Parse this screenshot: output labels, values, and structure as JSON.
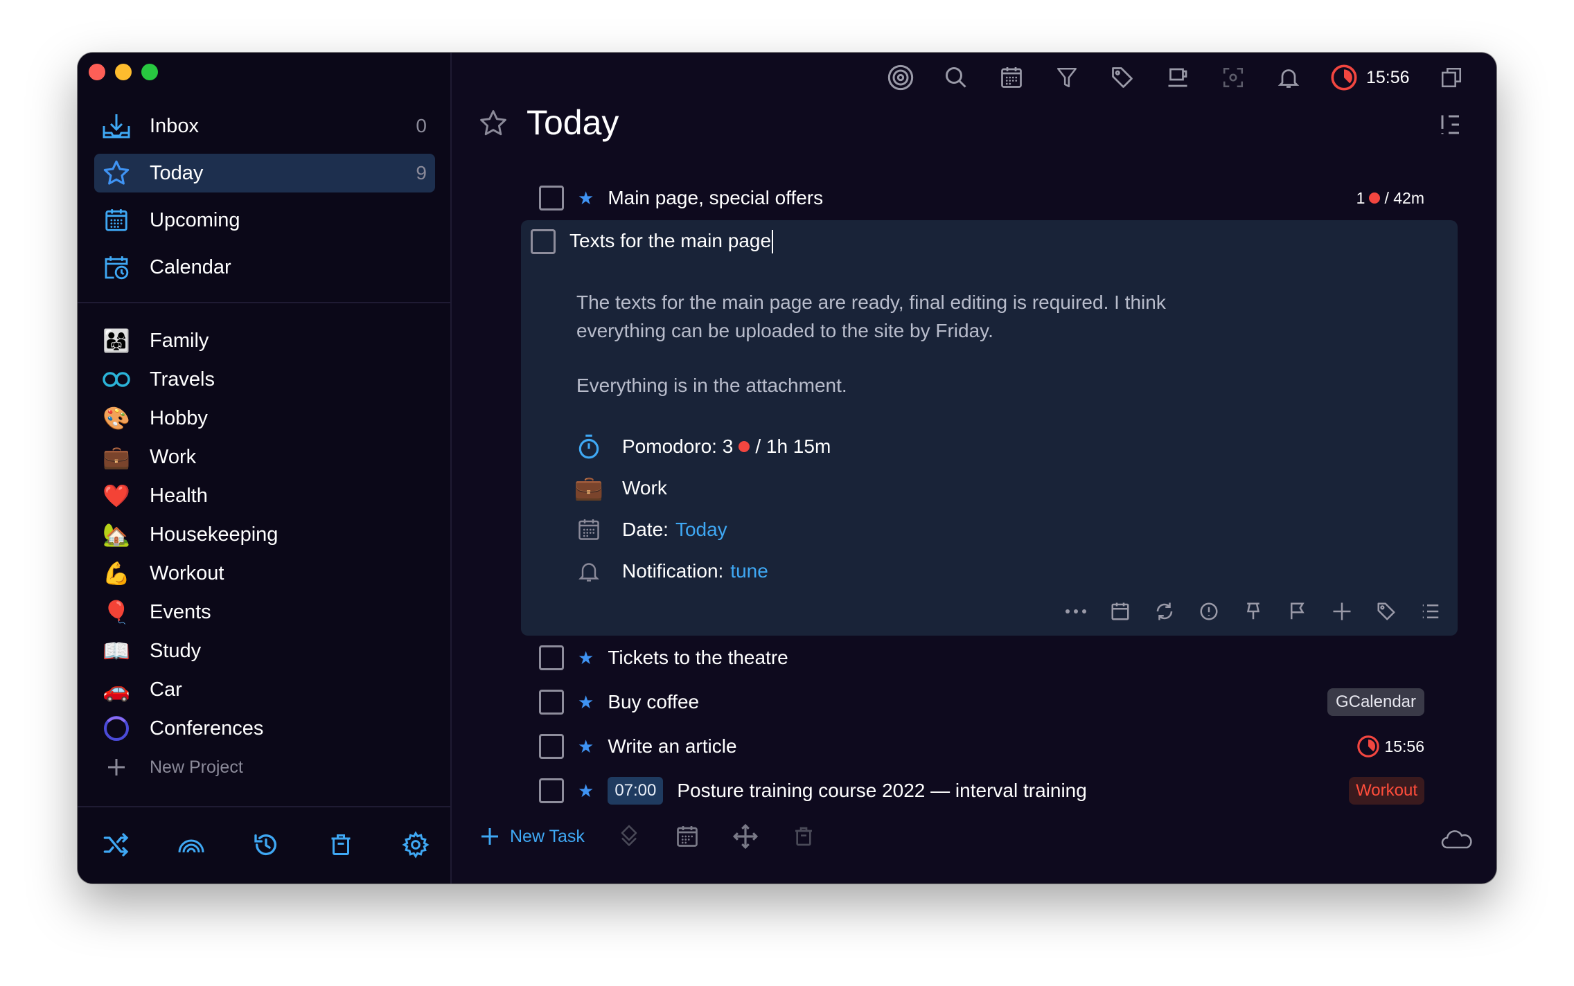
{
  "sidebar": {
    "nav": [
      {
        "label": "Inbox",
        "count": "0",
        "icon": "inbox-icon"
      },
      {
        "label": "Today",
        "count": "9",
        "icon": "star-icon"
      },
      {
        "label": "Upcoming",
        "count": "",
        "icon": "calendar-grid-icon"
      },
      {
        "label": "Calendar",
        "count": "",
        "icon": "calendar-clock-icon"
      }
    ],
    "projects": [
      {
        "label": "Family",
        "emoji": "👨‍👩‍👧"
      },
      {
        "label": "Travels",
        "emoji": "∞"
      },
      {
        "label": "Hobby",
        "emoji": "🎨"
      },
      {
        "label": "Work",
        "emoji": "💼"
      },
      {
        "label": "Health",
        "emoji": "❤️"
      },
      {
        "label": "Housekeeping",
        "emoji": "🏡"
      },
      {
        "label": "Workout",
        "emoji": "💪"
      },
      {
        "label": "Events",
        "emoji": "🎈"
      },
      {
        "label": "Study",
        "emoji": "📖"
      },
      {
        "label": "Car",
        "emoji": "🚗"
      },
      {
        "label": "Conferences",
        "emoji": "◯"
      }
    ],
    "new_project": "New Project"
  },
  "toolbar": {
    "time": "15:56"
  },
  "main": {
    "title": "Today",
    "tasks": {
      "t1": {
        "name": "Main page, special offers",
        "pomodoro_count": "1",
        "pomodoro_time": "/ 42m"
      },
      "expanded": {
        "name": "Texts for the main page",
        "desc1": "The texts for the main page are ready, final editing is required. I think everything can be uploaded to the site by Friday.",
        "desc2": "Everything is in the attachment.",
        "pomodoro_label": "Pomodoro: 3",
        "pomodoro_time": "/ 1h 15m",
        "project": "Work",
        "date_label": "Date:",
        "date_value": "Today",
        "notif_label": "Notification:",
        "notif_value": "tune"
      },
      "t3": {
        "name": "Tickets to the theatre"
      },
      "t4": {
        "name": "Buy coffee",
        "badge": "GCalendar"
      },
      "t5": {
        "name": "Write an article",
        "time": "15:56"
      },
      "t6": {
        "name": "Posture training course 2022 — interval training",
        "time_badge": "07:00",
        "tag": "Workout"
      }
    }
  },
  "footer": {
    "new_task": "New Task"
  },
  "colors": {
    "accent": "#3fa8f4",
    "star": "#3f93f3",
    "window_bg": "#0e0a1e",
    "selected_bg": "#1d2f4e",
    "expanded_bg": "#192338",
    "pomodoro_red": "#f24640"
  }
}
